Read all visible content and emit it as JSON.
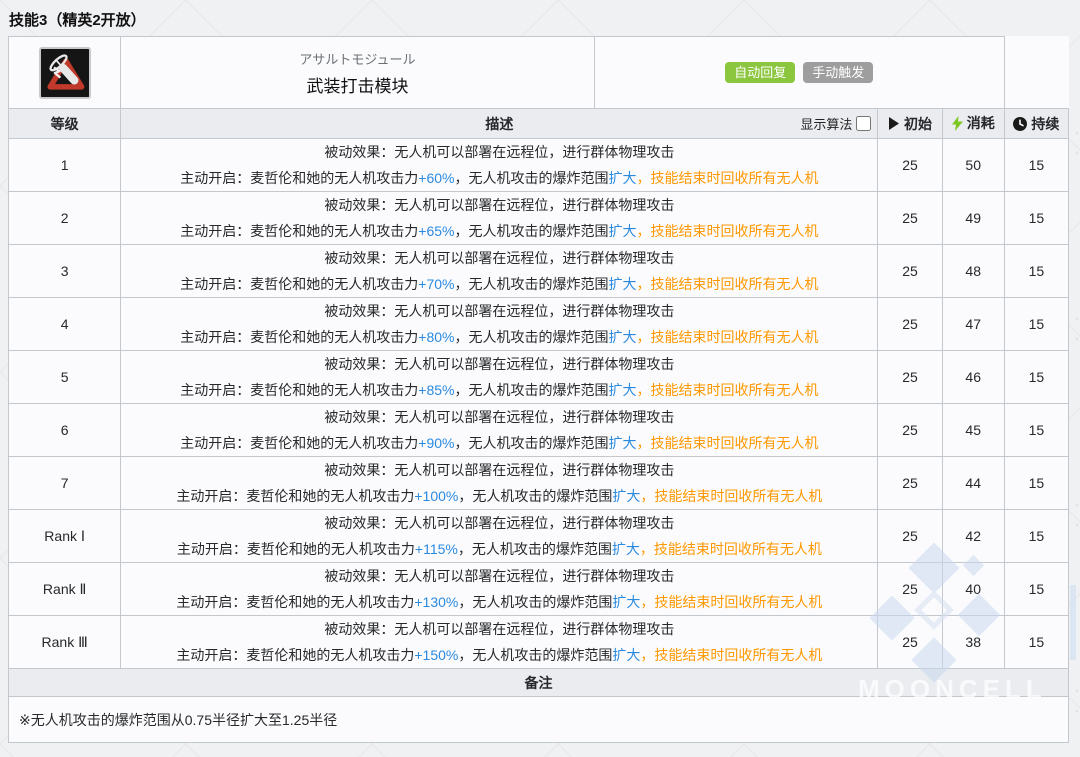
{
  "page": {
    "title": "技能3（精英2开放）"
  },
  "skill": {
    "icon_name": "assault-module-skill-icon",
    "name_jp": "アサルトモジュール",
    "name_cn": "武装打击模块",
    "badges": [
      {
        "label": "自动回复",
        "color": "#8cc63e"
      },
      {
        "label": "手动触发",
        "color": "#9e9e9e"
      }
    ]
  },
  "table": {
    "headers": {
      "level": "等级",
      "description": "描述",
      "show_algorithm_label": "显示算法",
      "initial": "初始",
      "cost": "消耗",
      "duration": "持续"
    },
    "show_algorithm_checked": false,
    "row_text": {
      "passive_line": "被动效果：无人机可以部署在远程位，进行群体物理攻击",
      "active_prefix": "主动开启：麦哲伦和她的无人机攻击力",
      "active_mid": "，无人机攻击的爆炸范围",
      "expand_word": "扩大",
      "active_suffix": "，技能结束时回收所有无人机"
    },
    "rows": [
      {
        "level": "1",
        "atk_bonus": "+60%",
        "initial": "25",
        "cost": "50",
        "duration": "15"
      },
      {
        "level": "2",
        "atk_bonus": "+65%",
        "initial": "25",
        "cost": "49",
        "duration": "15"
      },
      {
        "level": "3",
        "atk_bonus": "+70%",
        "initial": "25",
        "cost": "48",
        "duration": "15"
      },
      {
        "level": "4",
        "atk_bonus": "+80%",
        "initial": "25",
        "cost": "47",
        "duration": "15"
      },
      {
        "level": "5",
        "atk_bonus": "+85%",
        "initial": "25",
        "cost": "46",
        "duration": "15"
      },
      {
        "level": "6",
        "atk_bonus": "+90%",
        "initial": "25",
        "cost": "45",
        "duration": "15"
      },
      {
        "level": "7",
        "atk_bonus": "+100%",
        "initial": "25",
        "cost": "44",
        "duration": "15"
      },
      {
        "level": "Rank Ⅰ",
        "atk_bonus": "+115%",
        "initial": "25",
        "cost": "42",
        "duration": "15"
      },
      {
        "level": "Rank Ⅱ",
        "atk_bonus": "+130%",
        "initial": "25",
        "cost": "40",
        "duration": "15"
      },
      {
        "level": "Rank Ⅲ",
        "atk_bonus": "+150%",
        "initial": "25",
        "cost": "38",
        "duration": "15"
      }
    ]
  },
  "notes": {
    "header": "备注",
    "text": "※无人机攻击的爆炸范围从0.75半径扩大至1.25半径"
  },
  "watermark": {
    "text": "MOONCELL"
  },
  "colors": {
    "highlight_blue": "#2a8ae0",
    "highlight_orange": "#ff9800",
    "badge_green": "#8cc63e",
    "badge_gray": "#9e9e9e",
    "header_bg": "#eaecf0",
    "cell_bg": "#fbfbfd",
    "bolt_green": "#7ec723"
  }
}
